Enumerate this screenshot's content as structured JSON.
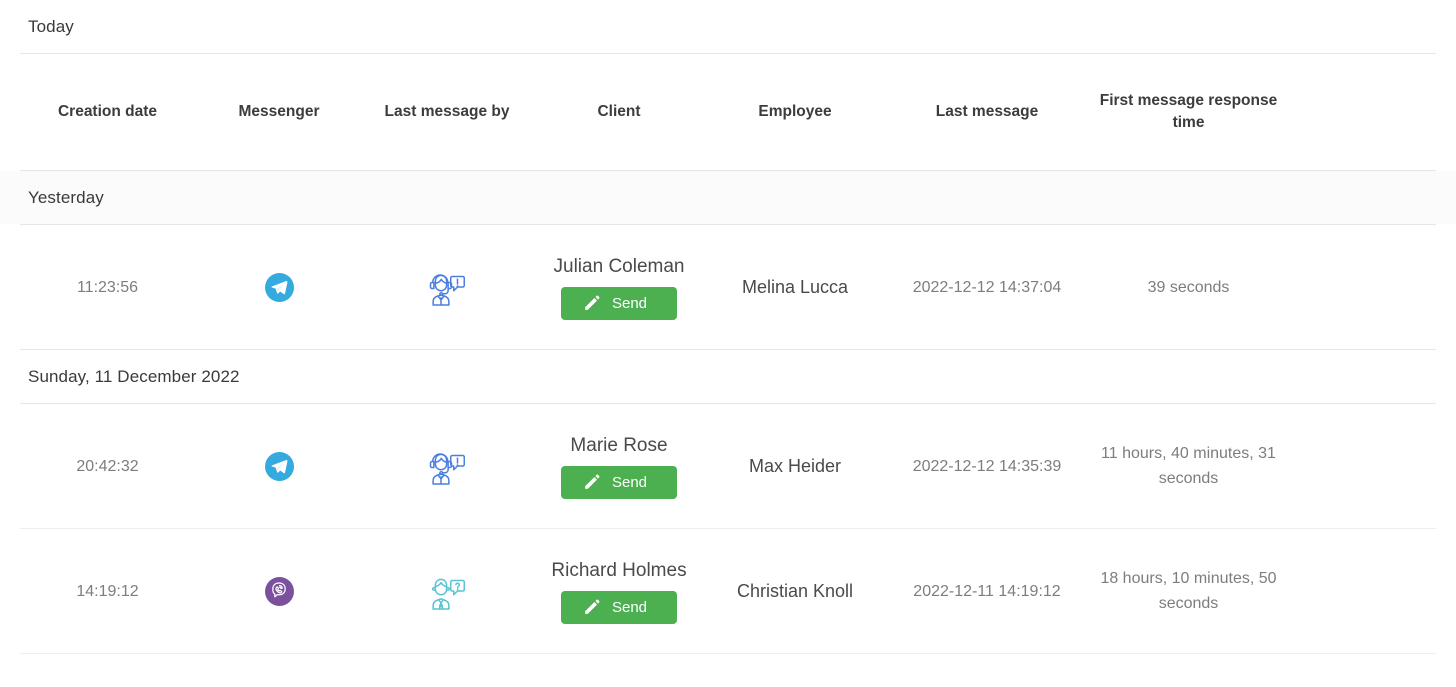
{
  "colors": {
    "telegram": "#34aadf",
    "viber": "#7b519d",
    "send_button": "#4caf50",
    "operator_icon": "#4a7fe0",
    "client_icon": "#57c4d4",
    "divider": "#e3e6ea"
  },
  "top_group": {
    "label": "Today"
  },
  "table": {
    "columns": [
      {
        "id": "creation-date",
        "label": "Creation date"
      },
      {
        "id": "messenger",
        "label": "Messenger"
      },
      {
        "id": "last-message-by",
        "label": "Last message by"
      },
      {
        "id": "client",
        "label": "Client"
      },
      {
        "id": "employee",
        "label": "Employee"
      },
      {
        "id": "last-message",
        "label": "Last message"
      },
      {
        "id": "first-message-response-time",
        "label": "First message response time"
      }
    ],
    "groups": [
      {
        "label": "Yesterday",
        "rows": [
          {
            "creation_date": "11:23:56",
            "messenger": "telegram",
            "messenger_label": "Telegram",
            "last_message_by": "operator",
            "last_message_by_label": "Operator",
            "client": "Julian Coleman",
            "send_label": "Send",
            "employee": "Melina Lucca",
            "last_message": "2022-12-12 14:37:04",
            "response_time": "39 seconds"
          }
        ]
      },
      {
        "label": "Sunday, 11 December 2022",
        "rows": [
          {
            "creation_date": "20:42:32",
            "messenger": "telegram",
            "messenger_label": "Telegram",
            "last_message_by": "operator",
            "last_message_by_label": "Operator",
            "client": "Marie Rose",
            "send_label": "Send",
            "employee": "Max Heider",
            "last_message": "2022-12-12 14:35:39",
            "response_time": "11 hours, 40 minutes, 31 seconds"
          },
          {
            "creation_date": "14:19:12",
            "messenger": "viber",
            "messenger_label": "Viber",
            "last_message_by": "client",
            "last_message_by_label": "Client",
            "client": "Richard Holmes",
            "send_label": "Send",
            "employee": "Christian Knoll",
            "last_message": "2022-12-11 14:19:12",
            "response_time": "18 hours, 10 minutes, 50 seconds"
          }
        ]
      }
    ]
  }
}
